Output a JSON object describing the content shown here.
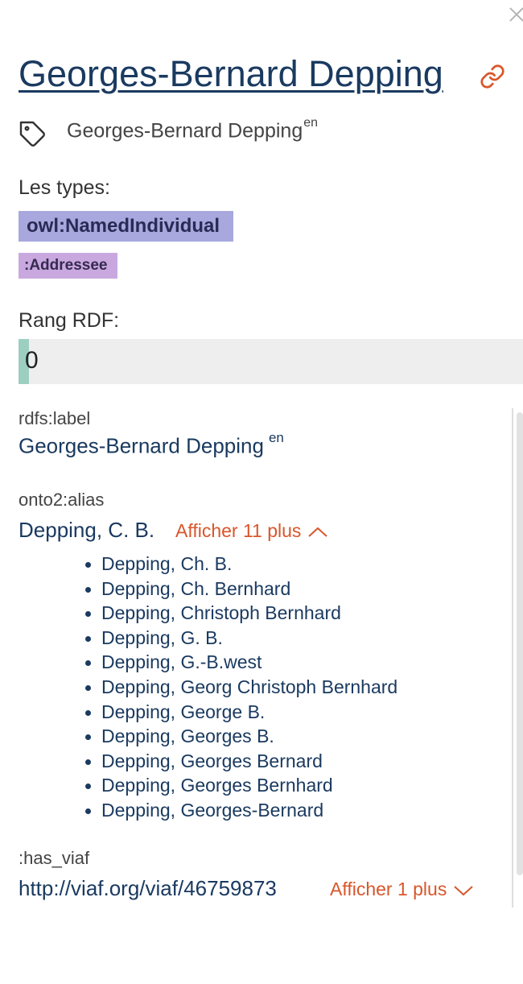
{
  "header": {
    "title": "Georges-Bernard Depping",
    "label": "Georges-Bernard Depping",
    "label_lang": "en"
  },
  "types": {
    "heading": "Les types:",
    "items": [
      "owl:NamedIndividual",
      ":Addressee"
    ]
  },
  "rank": {
    "heading": "Rang RDF:",
    "value": "0",
    "fraction": 0
  },
  "properties": {
    "label": {
      "name": "rdfs:label",
      "value": "Georges-Bernard Depping",
      "lang": "en"
    },
    "alias": {
      "name": "onto2:alias",
      "value": "Depping, C. B.",
      "toggle_label": "Afficher 11 plus",
      "expanded": true,
      "items": [
        "Depping, Ch. B.",
        "Depping, Ch. Bernhard",
        "Depping, Christoph Bernhard",
        "Depping, G. B.",
        "Depping, G.-B.west",
        "Depping, Georg Christoph Bernhard",
        "Depping, George B.",
        "Depping, Georges B.",
        "Depping, Georges Bernard",
        "Depping, Georges Bernhard",
        "Depping, Georges-Bernard"
      ]
    },
    "viaf": {
      "name": ":has_viaf",
      "value": "http://viaf.org/viaf/46759873",
      "toggle_label": "Afficher 1 plus",
      "expanded": false
    }
  },
  "icons": {
    "close": "close-icon",
    "link": "link-icon",
    "tag": "tag-icon",
    "chevron_up": "chevron-up-icon",
    "chevron_down": "chevron-down-icon"
  },
  "colors": {
    "title": "#1a3a60",
    "accent": "#d9562a",
    "type_badge_1": "#a8a8de",
    "type_badge_2": "#c9a8e0",
    "rank_fill": "#9dcfc0"
  }
}
